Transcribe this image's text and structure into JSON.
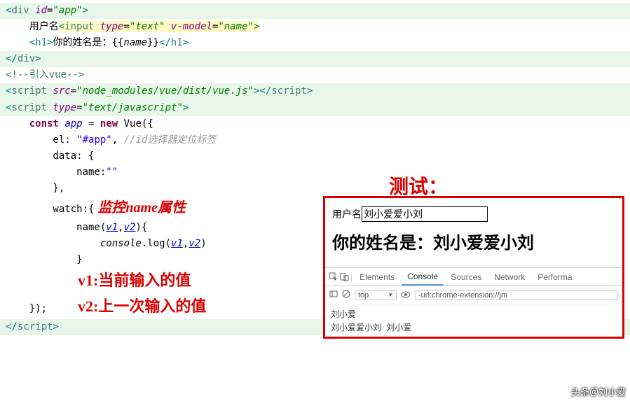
{
  "code": {
    "div_open": "<div id=\"app\">",
    "user_label_inline": "    用户名",
    "input_tag": "<input type=\"text\" v-model=\"name\">",
    "h1_open": "    <h1>",
    "h1_text": "你的姓名是：{{name}}",
    "h1_close": "</h1>",
    "div_close": "</div>",
    "comment_vue": "<!--引入vue-->",
    "script_vue": "<script src=\"node_modules/vue/dist/vue.js\"></script>",
    "script_js_open": "<script type=\"text/javascript\">",
    "const_app": "    const app = new Vue({",
    "el_line": "        el: \"#app\",",
    "el_comment": " //id选择器定位标签",
    "data_line": "        data: {",
    "name_line": "            name:\"\"",
    "brace1": "        },",
    "watch_line": "        watch:{",
    "watch_annotation": " 监控name属性",
    "name_fn": "            name(v1,v2){",
    "console_line": "                console.log(v1,v2)",
    "brace2": "            }",
    "v1_annotation": "        v1:当前输入的值",
    "brace3": "        }",
    "v2_annotation": "        v2:上一次输入的值",
    "close_vue": "    });",
    "script_close": "</script>"
  },
  "test": {
    "title": "测试：",
    "label": "用户名",
    "input_value": "刘小爱爱小刘",
    "heading": "你的姓名是：刘小爱爱小刘"
  },
  "devtools": {
    "tabs": [
      "Elements",
      "Console",
      "Sources",
      "Network",
      "Performa"
    ],
    "active_tab": "Console",
    "context": "top",
    "filter": "-url:chrome-extension://jm",
    "lines": [
      "刘小爱",
      "刘小爱爱小刘 刘小爱"
    ]
  },
  "watermark": "头条＠刘小爱"
}
